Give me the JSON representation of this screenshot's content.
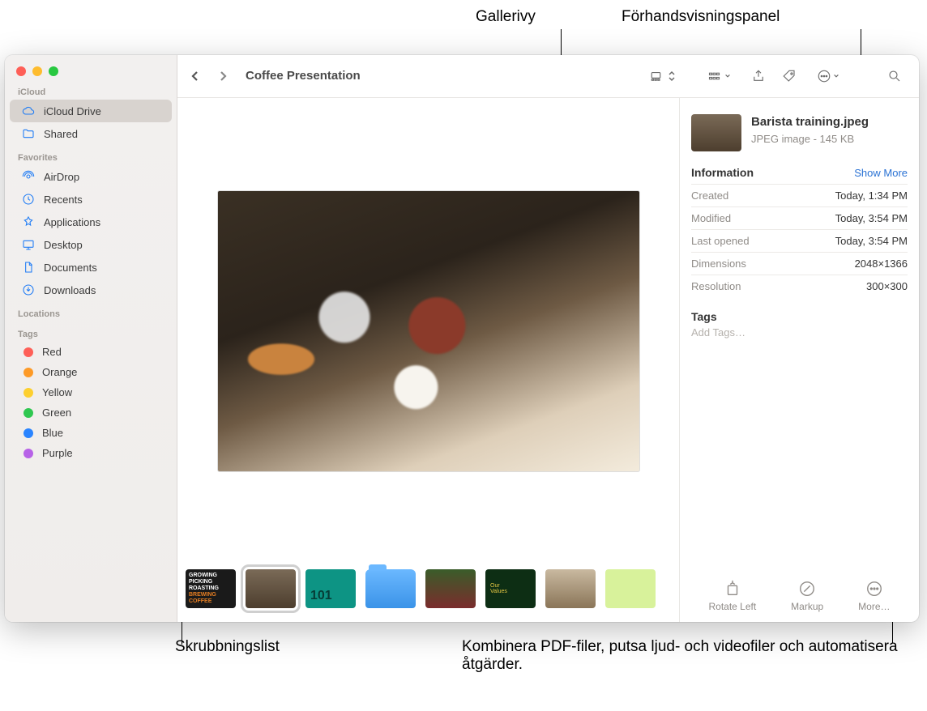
{
  "callouts": {
    "gallery_view": "Gallerivy",
    "preview_panel": "Förhandsvisningspanel",
    "scrubbing_strip": "Skrubbningslist",
    "more_actions": "Kombinera PDF-filer, putsa ljud- och videofiler och automatisera åtgärder."
  },
  "toolbar": {
    "title": "Coffee Presentation"
  },
  "sidebar": {
    "sections": {
      "icloud_title": "iCloud",
      "favorites_title": "Favorites",
      "locations_title": "Locations",
      "tags_title": "Tags"
    },
    "icloud": [
      {
        "label": "iCloud Drive",
        "icon": "cloud",
        "selected": true
      },
      {
        "label": "Shared",
        "icon": "folder-shared",
        "selected": false
      }
    ],
    "favorites": [
      {
        "label": "AirDrop",
        "icon": "airdrop"
      },
      {
        "label": "Recents",
        "icon": "clock"
      },
      {
        "label": "Applications",
        "icon": "apps"
      },
      {
        "label": "Desktop",
        "icon": "desktop"
      },
      {
        "label": "Documents",
        "icon": "doc"
      },
      {
        "label": "Downloads",
        "icon": "download"
      }
    ],
    "tags": [
      {
        "label": "Red",
        "color": "#fe5f57"
      },
      {
        "label": "Orange",
        "color": "#fd9a27"
      },
      {
        "label": "Yellow",
        "color": "#fdcf2f"
      },
      {
        "label": "Green",
        "color": "#2fc750"
      },
      {
        "label": "Blue",
        "color": "#2a84ff"
      },
      {
        "label": "Purple",
        "color": "#b762e7"
      }
    ]
  },
  "thumbs": {
    "t1": {
      "l1": "GROWING",
      "l2": "PICKING",
      "l3": "ROASTING",
      "l4": "BREWING",
      "l5": "COFFEE"
    },
    "t3_label": "101",
    "t6": {
      "l1": "Our",
      "l2": "Values"
    }
  },
  "preview": {
    "filename": "Barista training.jpeg",
    "subtitle": "JPEG image - 145 KB",
    "info_title": "Information",
    "show_more": "Show More",
    "rows": [
      {
        "k": "Created",
        "v": "Today, 1:34 PM"
      },
      {
        "k": "Modified",
        "v": "Today, 3:54 PM"
      },
      {
        "k": "Last opened",
        "v": "Today, 3:54 PM"
      },
      {
        "k": "Dimensions",
        "v": "2048×1366"
      },
      {
        "k": "Resolution",
        "v": "300×300"
      }
    ],
    "tags_title": "Tags",
    "add_tags": "Add Tags…",
    "actions": {
      "rotate": "Rotate Left",
      "markup": "Markup",
      "more": "More…"
    }
  }
}
